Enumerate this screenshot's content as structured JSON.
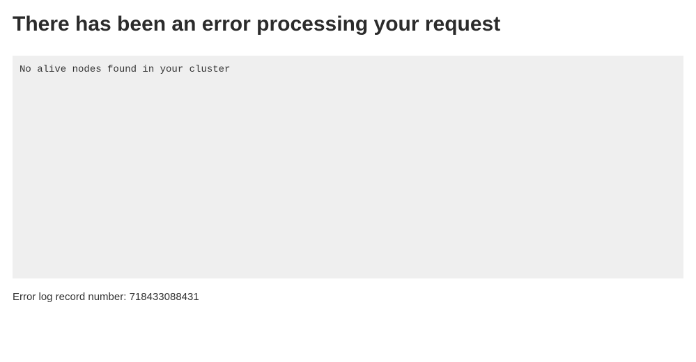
{
  "heading": "There has been an error processing your request",
  "error_message": "No alive nodes found in your cluster",
  "log_label": "Error log record number: ",
  "log_number": "718433088431"
}
